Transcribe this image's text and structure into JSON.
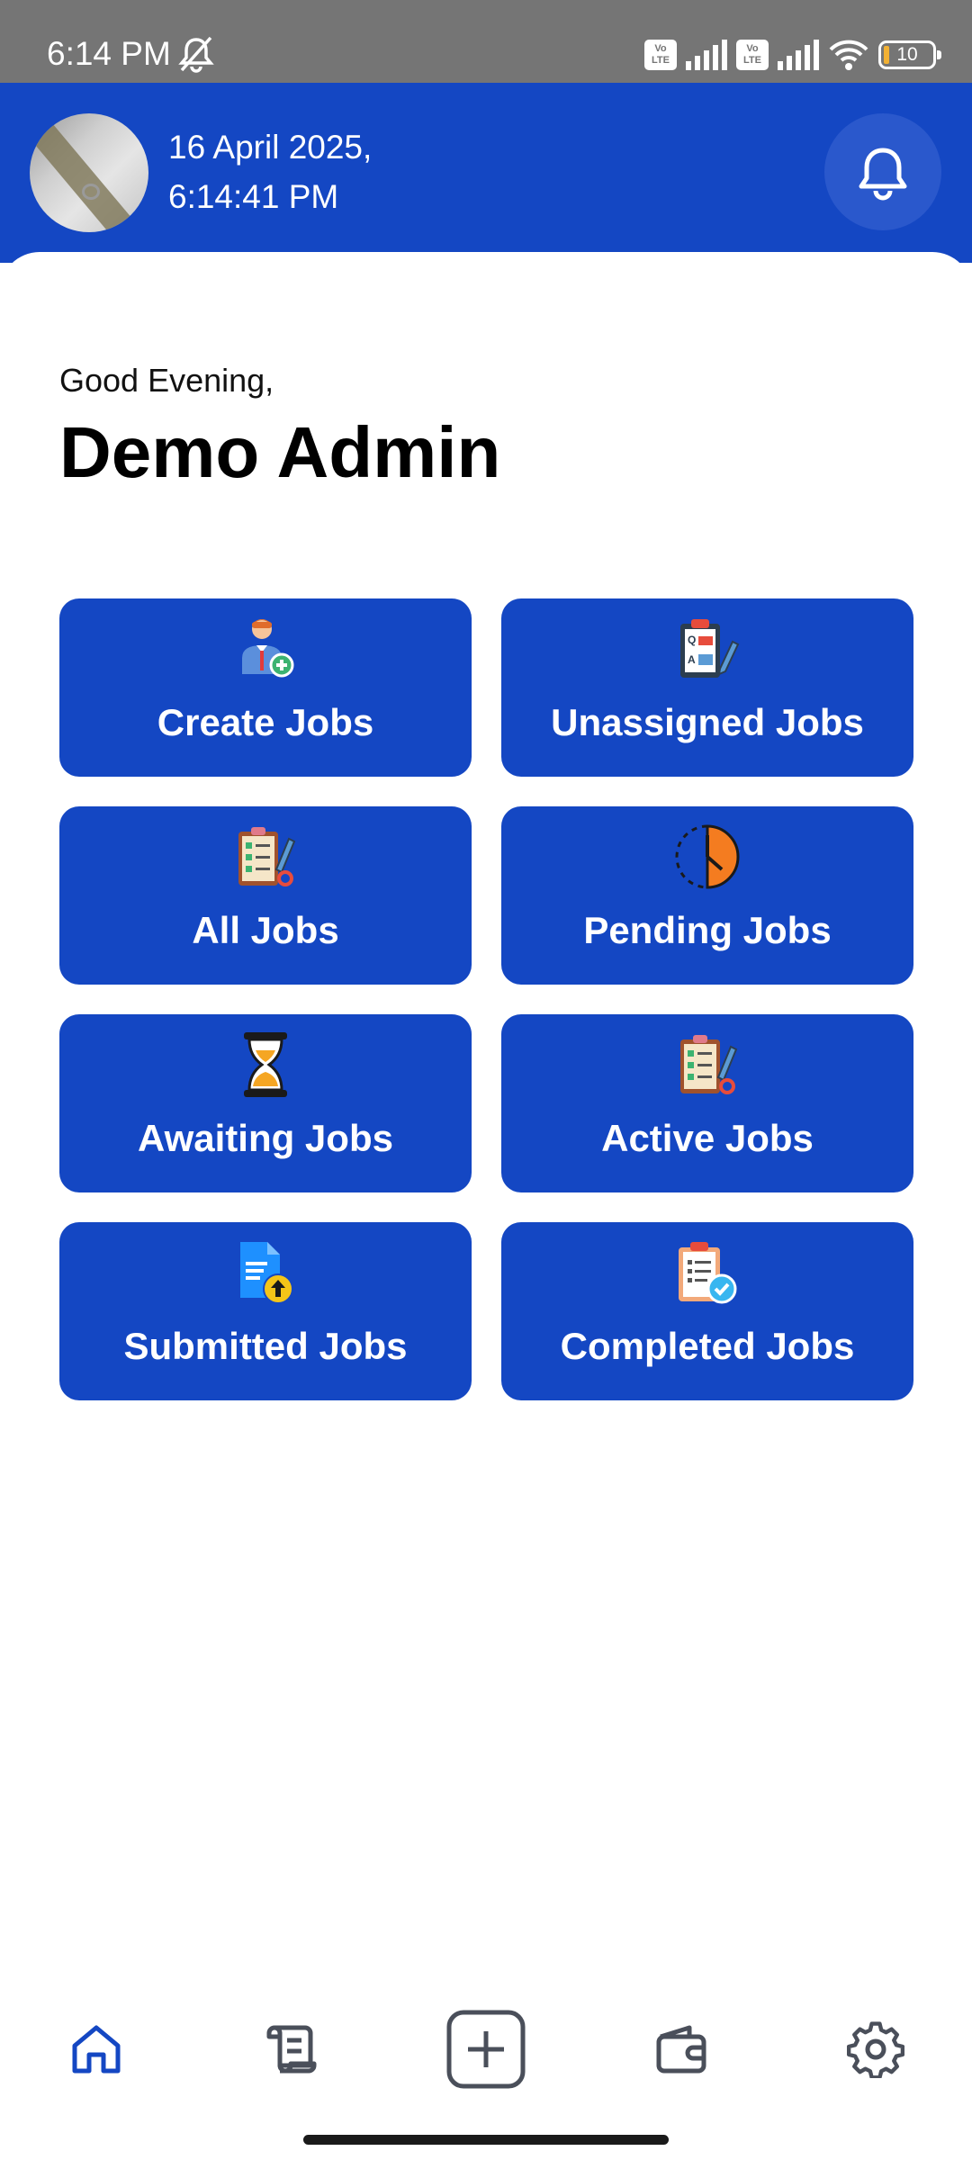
{
  "status_bar": {
    "time": "6:14 PM",
    "icons": [
      "mute-icon",
      "volte-icon",
      "signal-icon",
      "volte-icon",
      "signal-icon",
      "wifi-icon"
    ],
    "volte_label": "Vo LTE",
    "battery_level": "10"
  },
  "header": {
    "date_line": "16 April 2025,",
    "time_line": "6:14:41 PM",
    "bell_icon": "bell-icon",
    "background_color": "#1447c3"
  },
  "greeting": {
    "salutation": "Good Evening,",
    "user_name": "Demo Admin"
  },
  "tiles": [
    {
      "label": "Create Jobs",
      "icon": "add-user-icon"
    },
    {
      "label": "Unassigned Jobs",
      "icon": "clipboard-qa-icon"
    },
    {
      "label": "All Jobs",
      "icon": "checklist-icon"
    },
    {
      "label": "Pending Jobs",
      "icon": "pending-clock-icon"
    },
    {
      "label": "Awaiting Jobs",
      "icon": "hourglass-icon"
    },
    {
      "label": "Active Jobs",
      "icon": "active-checklist-icon"
    },
    {
      "label": "Submitted Jobs",
      "icon": "upload-document-icon"
    },
    {
      "label": "Completed Jobs",
      "icon": "completed-clipboard-icon"
    }
  ],
  "bottom_nav": [
    {
      "name": "home",
      "icon": "home-icon",
      "active": true
    },
    {
      "name": "jobs",
      "icon": "scroll-icon",
      "active": false
    },
    {
      "name": "add",
      "icon": "plus-square-icon",
      "active": false
    },
    {
      "name": "wallet",
      "icon": "wallet-icon",
      "active": false
    },
    {
      "name": "settings",
      "icon": "gear-icon",
      "active": false
    }
  ],
  "colors": {
    "primary": "#1447c3",
    "status_bar": "#757575",
    "nav_active": "#1447c3",
    "nav_inactive": "#4a4f5a"
  }
}
